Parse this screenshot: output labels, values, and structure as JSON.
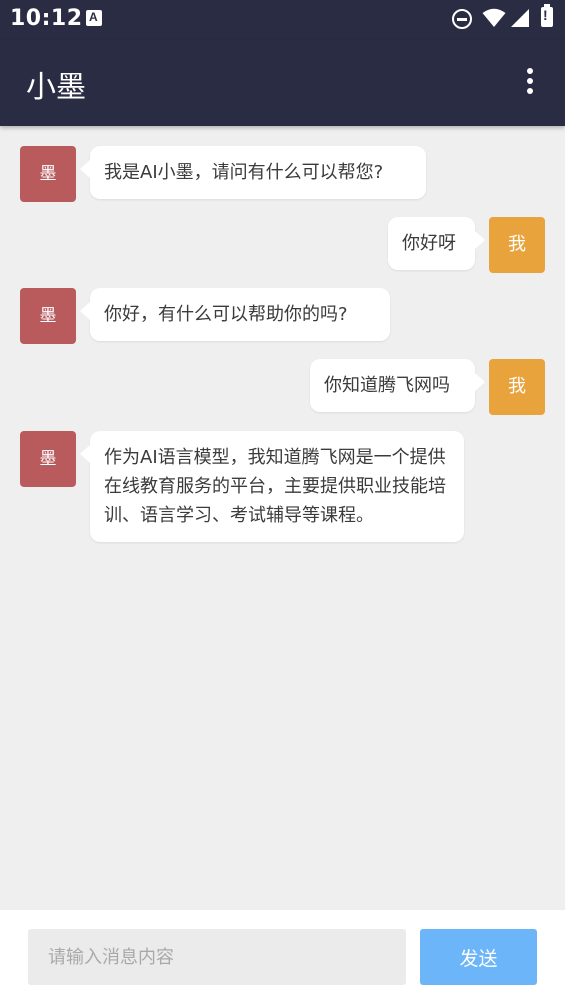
{
  "status_bar": {
    "time": "10:12",
    "notification_glyph": "A",
    "battery_glyph": "!",
    "icons": [
      "notification-a-icon",
      "do-not-disturb-icon",
      "wifi-icon",
      "cellular-signal-icon",
      "battery-alert-icon"
    ]
  },
  "app_bar": {
    "title": "小墨",
    "menu_icon": "more-vertical-icon"
  },
  "messages": [
    {
      "sender": "ai",
      "avatar_label": "墨",
      "text": "我是AI小墨，请问有什么可以帮您?"
    },
    {
      "sender": "me",
      "avatar_label": "我",
      "text": "你好呀"
    },
    {
      "sender": "ai",
      "avatar_label": "墨",
      "text": "你好，有什么可以帮助你的吗?"
    },
    {
      "sender": "me",
      "avatar_label": "我",
      "text": "你知道腾飞网吗"
    },
    {
      "sender": "ai",
      "avatar_label": "墨",
      "text": "作为AI语言模型，我知道腾飞网是一个提供在线教育服务的平台，主要提供职业技能培训、语言学习、考试辅导等课程。"
    }
  ],
  "input_bar": {
    "value": "",
    "placeholder": "请输入消息内容",
    "send_label": "发送"
  },
  "colors": {
    "header_bg": "#2a2c43",
    "chat_bg": "#efefef",
    "ai_avatar": "#b95b5d",
    "me_avatar": "#e8a33d",
    "send_button": "#6cb5f9"
  }
}
